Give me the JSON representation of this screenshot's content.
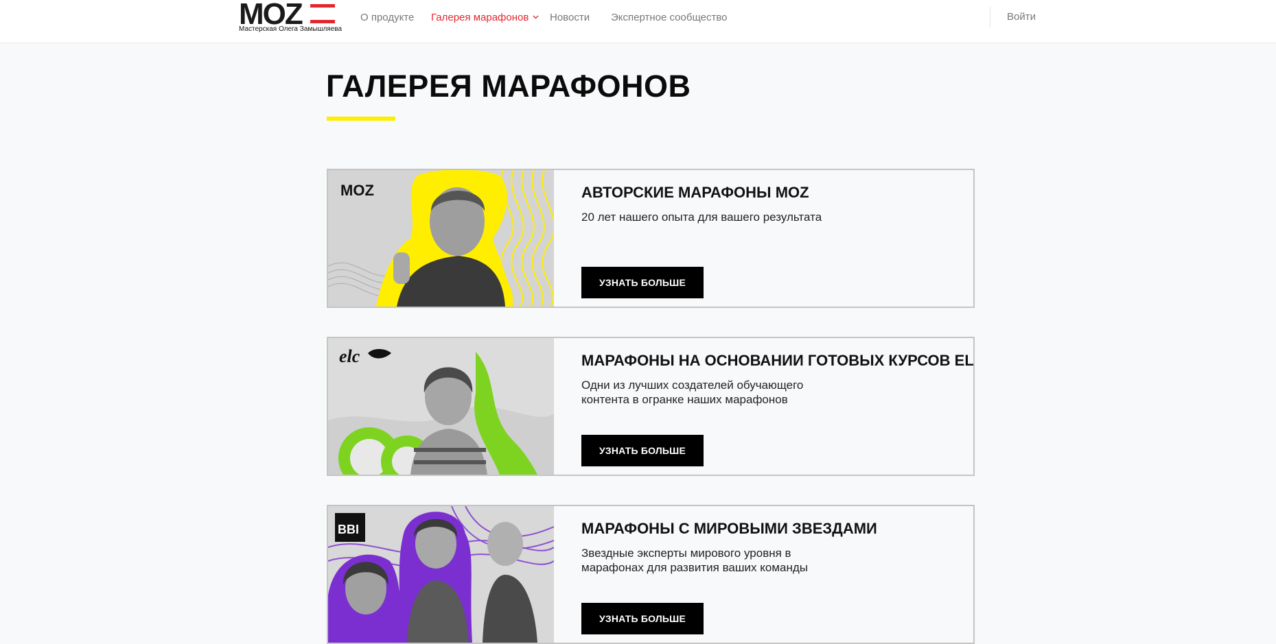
{
  "header": {
    "logo_text": "MOZ",
    "logo_subtitle": "Мастерская Олега Замышляева",
    "nav": [
      {
        "label": "О продукте"
      },
      {
        "label": "Галерея марафонов"
      },
      {
        "label": "Новости"
      },
      {
        "label": "Экспертное сообщество"
      }
    ],
    "login_label": "Войти"
  },
  "page": {
    "title": "ГАЛЕРЕЯ МАРАФОНОВ"
  },
  "cards": [
    {
      "title": "АВТОРСКИЕ МАРАФОНЫ MOZ",
      "description": "20 лет нашего опыта для вашего результата",
      "button_label": "УЗНАТЬ БОЛЬШЕ",
      "image_badge": "MOZ"
    },
    {
      "title": "МАРАФОНЫ НА ОСНОВАНИИ ГОТОВЫХ КУРСОВ ELC",
      "description": "Одни из лучших создателей обучающего контента в огранке наших марафонов",
      "button_label": "УЗНАТЬ БОЛЬШЕ",
      "image_badge": "elc"
    },
    {
      "title": "МАРАФОНЫ С МИРОВЫМИ ЗВЕЗДАМИ",
      "description": "Звездные эксперты мирового уровня в марафонах для развития ваших команды",
      "button_label": "УЗНАТЬ БОЛЬШЕ",
      "image_badge": "BBI"
    }
  ],
  "colors": {
    "accent_red": "#e6262e",
    "accent_yellow": "#ffee00",
    "accent_green": "#7ed321",
    "accent_purple": "#7b2fd0"
  },
  "icons": {
    "dropdown": "chevron-down-icon"
  }
}
